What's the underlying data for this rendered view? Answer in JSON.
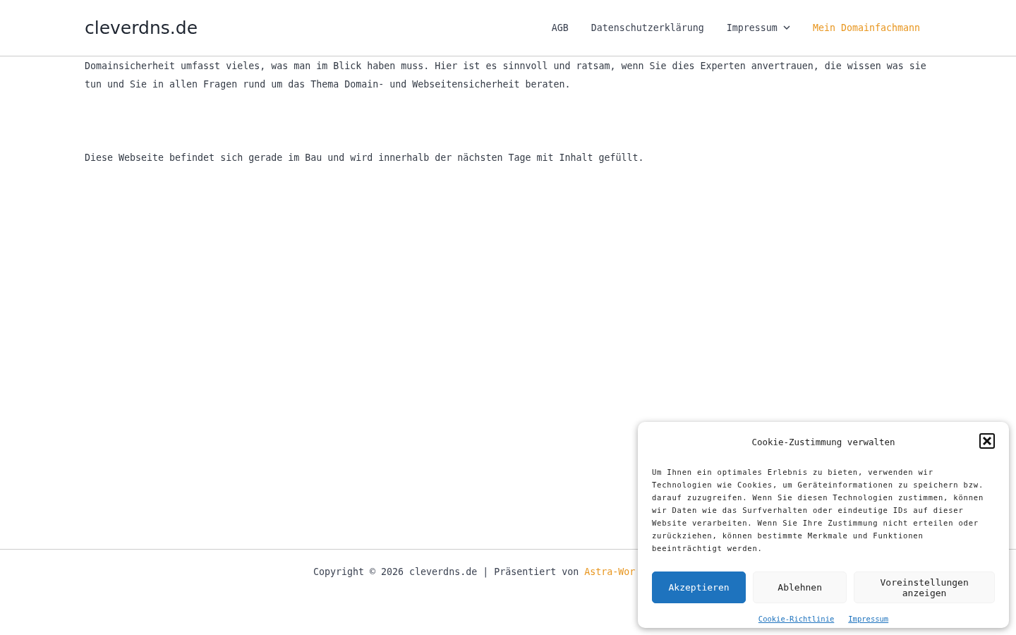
{
  "header": {
    "logo": "cleverdns.de",
    "nav": [
      {
        "label": "AGB",
        "selected": false,
        "has_submenu": false
      },
      {
        "label": "Datenschutzerklärung",
        "selected": false,
        "has_submenu": false
      },
      {
        "label": "Impressum",
        "selected": false,
        "has_submenu": true
      },
      {
        "label": "Mein Domainfachmann",
        "selected": true,
        "has_submenu": false
      }
    ]
  },
  "content": {
    "paragraphs": [
      "Domainsicherheit umfasst vieles, was man im Blick haben muss. Hier ist es sinnvoll und ratsam, wenn Sie dies Experten anvertrauen, die wissen was sie tun und Sie in allen Fragen rund um das Thema Domain- und Webseitensicherheit beraten.",
      "Diese Webseite befindet sich gerade im Bau und wird innerhalb der nächsten Tage mit Inhalt gefüllt."
    ]
  },
  "footer": {
    "text": "Copyright © 2026 cleverdns.de | Präsentiert von ",
    "link": "Astra-Wor"
  },
  "cookie_dialog": {
    "title": "Cookie-Zustimmung verwalten",
    "body": "Um Ihnen ein optimales Erlebnis zu bieten, verwenden wir Technologien wie Cookies, um Geräteinformationen zu speichern bzw. darauf zuzugreifen. Wenn Sie diesen Technologien zustimmen, können wir Daten wie das Surfverhalten oder eindeutige IDs auf dieser Website verarbeiten. Wenn Sie Ihre Zustimmung nicht erteilen oder zurückziehen, können bestimmte Merkmale und Funktionen beeinträchtigt werden.",
    "buttons": [
      {
        "label": "Akzeptieren",
        "kind": "primary"
      },
      {
        "label": "Ablehnen",
        "kind": "secondary"
      },
      {
        "label": "Voreinstellungen anzeigen",
        "kind": "secondary"
      }
    ],
    "links": [
      "Cookie-Richtlinie",
      "Impressum"
    ]
  }
}
